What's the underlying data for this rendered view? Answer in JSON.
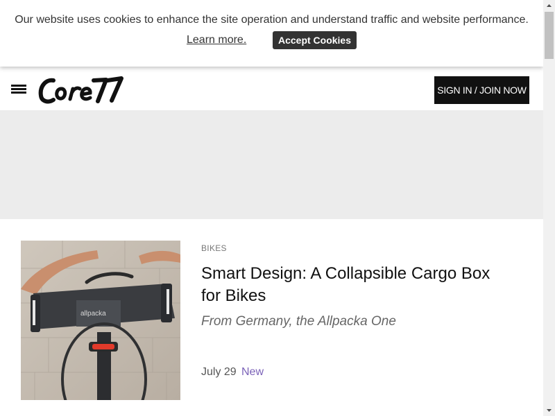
{
  "cookie_banner": {
    "message": "Our website uses cookies to enhance the site operation and understand traffic and website performance.",
    "learn_more": "Learn more.",
    "accept_label": "Accept Cookies"
  },
  "header": {
    "logo_text": "CORE77",
    "menu_icon": "hamburger-menu-icon",
    "signin_label": "SIGN IN / JOIN NOW"
  },
  "article": {
    "category": "BIKES",
    "title": "Smart Design: A Collapsible Cargo Box for Bikes",
    "subtitle": "From Germany, the Allpacka One",
    "date": "July 29",
    "badge": "New",
    "image_label": "allpacka"
  },
  "colors": {
    "banner_button": "#333333",
    "signin_button": "#111111",
    "ad_background": "#ececec",
    "badge": "#7b62b8"
  }
}
